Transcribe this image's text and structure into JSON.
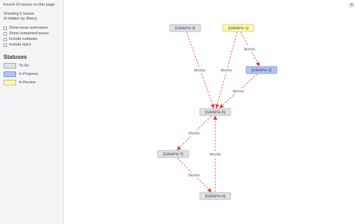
{
  "sidebar": {
    "found_text": "Found 10 issues on this page",
    "showing_text": "Showing 6 issues",
    "hidden_text": "(4 hidden by filters)",
    "options": [
      {
        "label": "Show issue summaries",
        "checked": false
      },
      {
        "label": "Show completed issues",
        "checked": false
      },
      {
        "label": "Include subtasks",
        "checked": false
      },
      {
        "label": "Include epics",
        "checked": false
      }
    ],
    "statuses_title": "Statuses",
    "statuses": [
      {
        "label": "To Do",
        "fill": "#dfe1e6",
        "stroke": "#a5adba"
      },
      {
        "label": "In Progress",
        "fill": "#b3c3f5",
        "stroke": "#7a8fd6"
      },
      {
        "label": "In Review",
        "fill": "#fffab0",
        "stroke": "#c8c26a"
      }
    ]
  },
  "close_label": "×",
  "graph": {
    "nodes": [
      {
        "id": "GRAPH-3",
        "label": "[GRAPH-3]",
        "status": "To Do"
      },
      {
        "id": "GRAPH-1",
        "label": "[GRAPH-1]",
        "status": "In Review"
      },
      {
        "id": "GRAPH-2",
        "label": "[GRAPH-2]",
        "status": "In Progress"
      },
      {
        "id": "GRAPH-5",
        "label": "[GRAPH-5]",
        "status": "To Do"
      },
      {
        "id": "GRAPH-7",
        "label": "[GRAPH-7]",
        "status": "To Do"
      },
      {
        "id": "GRAPH-6",
        "label": "[GRAPH-6]",
        "status": "To Do"
      }
    ],
    "edges": [
      {
        "from": "GRAPH-3",
        "to": "GRAPH-5",
        "label": "blocks"
      },
      {
        "from": "GRAPH-1",
        "to": "GRAPH-5",
        "label": "blocks"
      },
      {
        "from": "GRAPH-1",
        "to": "GRAPH-2",
        "label": "blocks"
      },
      {
        "from": "GRAPH-2",
        "to": "GRAPH-5",
        "label": "blocks"
      },
      {
        "from": "GRAPH-5",
        "to": "GRAPH-7",
        "label": "blocks"
      },
      {
        "from": "GRAPH-7",
        "to": "GRAPH-6",
        "label": "blocks"
      },
      {
        "from": "GRAPH-6",
        "to": "GRAPH-5",
        "label": "blocks"
      }
    ],
    "edge_color": "#e53935"
  }
}
